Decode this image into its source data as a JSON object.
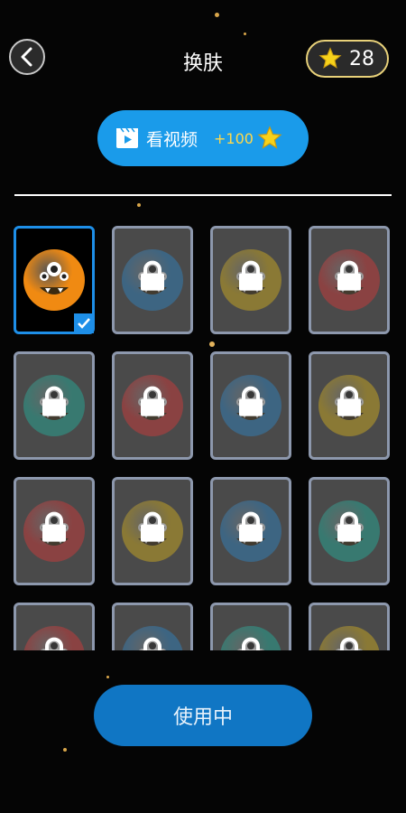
{
  "header": {
    "title": "换肤",
    "back_icon": "chevron-left-icon",
    "coins": "28"
  },
  "video_button": {
    "label": "看视频",
    "reward": "+100",
    "icon": "video-play-icon"
  },
  "skins": [
    {
      "color": "#f08a12",
      "state": "selected"
    },
    {
      "color": "#2f86c6",
      "state": "locked"
    },
    {
      "color": "#d8b21c",
      "state": "locked"
    },
    {
      "color": "#d83a3a",
      "state": "locked"
    },
    {
      "color": "#23b3a0",
      "state": "locked"
    },
    {
      "color": "#d83a3a",
      "state": "locked"
    },
    {
      "color": "#2f86c6",
      "state": "locked"
    },
    {
      "color": "#d8b21c",
      "state": "locked"
    },
    {
      "color": "#d83a3a",
      "state": "locked"
    },
    {
      "color": "#d8b21c",
      "state": "locked"
    },
    {
      "color": "#2f86c6",
      "state": "locked"
    },
    {
      "color": "#23b3a0",
      "state": "locked"
    },
    {
      "color": "#d83a3a",
      "state": "locked"
    },
    {
      "color": "#2f86c6",
      "state": "locked"
    },
    {
      "color": "#23b3a0",
      "state": "locked"
    },
    {
      "color": "#d8b21c",
      "state": "locked"
    }
  ],
  "use_button": {
    "label": "使用中"
  },
  "colors": {
    "accent": "#1a9bea",
    "selected_border": "#1e8fe8",
    "coin_border": "#e9d27a"
  }
}
